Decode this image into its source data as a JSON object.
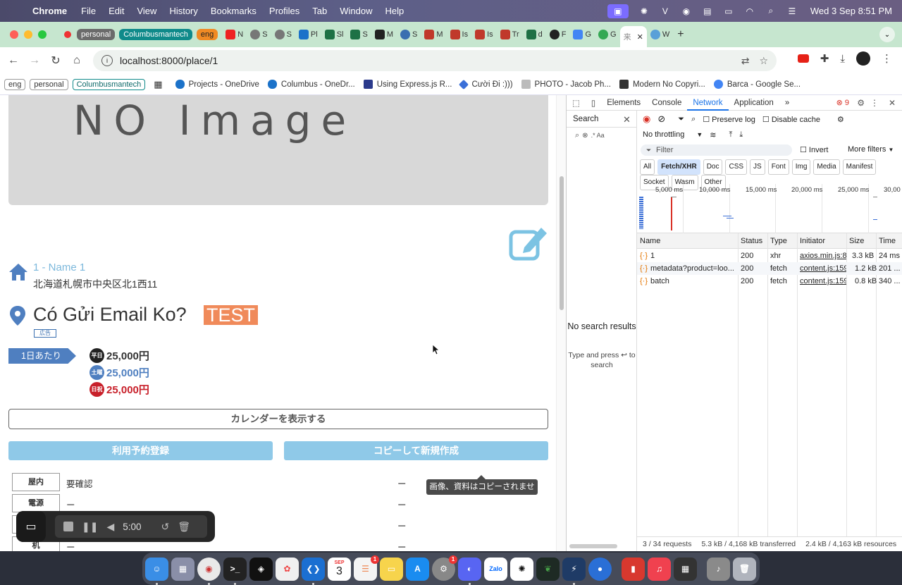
{
  "menubar": {
    "app": "Chrome",
    "menus": [
      "File",
      "Edit",
      "View",
      "History",
      "Bookmarks",
      "Profiles",
      "Tab",
      "Window",
      "Help"
    ],
    "clock": "Wed 3 Sep  8:51 PM"
  },
  "tabs": {
    "groups": [
      "personal",
      "Columbusmantech",
      "eng"
    ],
    "items": [
      "N",
      "S",
      "S",
      "Pl",
      "Sl",
      "S",
      "M",
      "S",
      "M",
      "Is",
      "Is",
      "Tr",
      "d",
      "F",
      "G",
      "G",
      "W"
    ],
    "active_letter": "来"
  },
  "toolbar": {
    "url": "localhost:8000/place/1"
  },
  "bookmarks": {
    "groups": [
      "eng",
      "personal",
      "Columbusmantech"
    ],
    "items": [
      "Projects - OneDrive",
      "Columbus - OneDr...",
      "Using Express.js R...",
      "Cười Đi :)))",
      "PHOTO - Jacob Ph...",
      "Modern No Copyri...",
      "Barca - Google Se..."
    ]
  },
  "page": {
    "noimage": "NO Image",
    "place_name": "1 - Name 1",
    "address": "北海道札幌市中央区北1西11",
    "title": "Có Gửi Email Ko?",
    "title_tag": "TEST",
    "small_tag": "広告",
    "day_rate_label": "1日あたり",
    "prices": [
      {
        "day": "平日",
        "amount": "25,000円"
      },
      {
        "day": "土曜",
        "amount": "25,000円"
      },
      {
        "day": "日祝",
        "amount": "25,000円"
      }
    ],
    "calendar_button": "カレンダーを表示する",
    "reserve_button": "利用予約登録",
    "copy_button": "コピーして新規作成",
    "tooltip": "画像、資料はコピーされません",
    "attributes": [
      {
        "label": "屋内",
        "value": "要確認",
        "extra": "ー"
      },
      {
        "label": "電源",
        "value": "ー",
        "extra": "ー"
      },
      {
        "label": "",
        "value": "",
        "extra": "ー"
      },
      {
        "label": "机",
        "value": "ー",
        "extra": "ー"
      }
    ]
  },
  "recorder": {
    "time": "5:00"
  },
  "devtools": {
    "tabs": [
      "Elements",
      "Console",
      "Network",
      "Application"
    ],
    "active_tab": "Network",
    "error_count": "9",
    "search_title": "Search",
    "search_hint": ".* Aa",
    "no_results": "No search results",
    "press_hint": "Type and press ↩ to search",
    "preserve_log": "Preserve log",
    "disable_cache": "Disable cache",
    "throttling": "No throttling",
    "filter_placeholder": "Filter",
    "invert": "Invert",
    "more_filters": "More filters",
    "chips": [
      "All",
      "Fetch/XHR",
      "Doc",
      "CSS",
      "JS",
      "Font",
      "Img",
      "Media",
      "Manifest",
      "Socket",
      "Wasm",
      "Other"
    ],
    "active_chip": "Fetch/XHR",
    "timeline_labels": [
      "5,000 ms",
      "10,000 ms",
      "15,000 ms",
      "20,000 ms",
      "25,000 ms",
      "30,00"
    ],
    "columns": [
      "Name",
      "Status",
      "Type",
      "Initiator",
      "Size",
      "Time"
    ],
    "rows": [
      {
        "name": "1",
        "status": "200",
        "type": "xhr",
        "initiator": "axios.min.js:8",
        "size": "3.3 kB",
        "time": "24 ms"
      },
      {
        "name": "metadata?product=loo...",
        "status": "200",
        "type": "fetch",
        "initiator": "content.js:159",
        "size": "1.2 kB",
        "time": "201 ..."
      },
      {
        "name": "batch",
        "status": "200",
        "type": "fetch",
        "initiator": "content.js:159",
        "size": "0.8 kB",
        "time": "340 ..."
      }
    ],
    "status": {
      "requests": "3 / 34 requests",
      "transferred": "5.3 kB / 4,168 kB transferred",
      "resources": "2.4 kB / 4,163 kB resources"
    }
  },
  "dock": {
    "calendar_day": "3",
    "calendar_month": "SEP",
    "badge": "1"
  }
}
